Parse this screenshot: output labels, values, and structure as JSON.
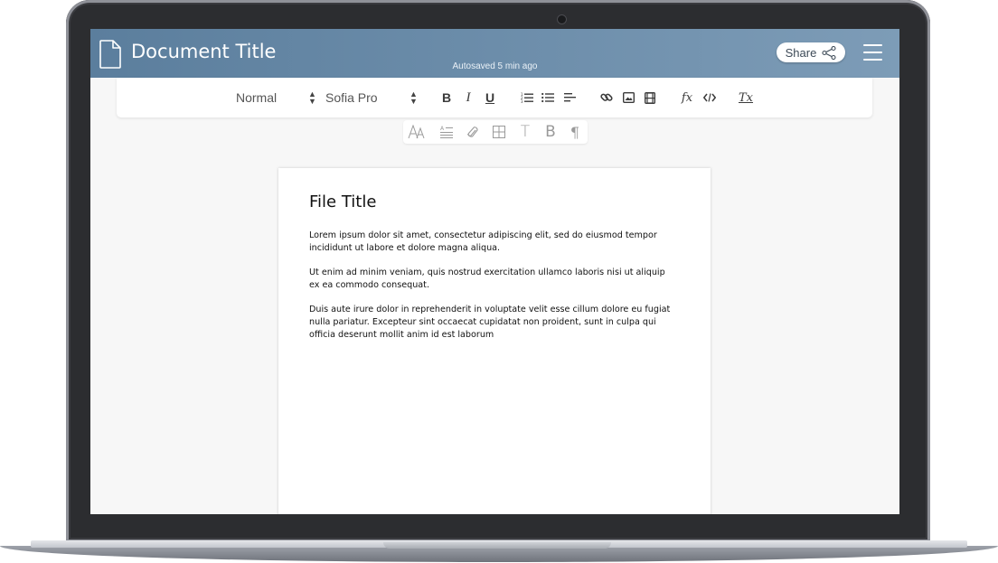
{
  "header": {
    "document_title": "Document Title",
    "autosave_status": "Autosaved 5 min ago",
    "share_label": "Share",
    "share_icon": "share-icon",
    "menu_icon": "hamburger-icon",
    "accent_gradient": [
      "#5b7e9d",
      "#7d9cb7"
    ]
  },
  "toolbar": {
    "style_select": "Normal",
    "font_select": "Sofia Pro",
    "buttons": {
      "bold": "B",
      "italic": "I",
      "underline": "U"
    },
    "icons": [
      "ordered-list-icon",
      "bullet-list-icon",
      "align-left-icon",
      "link-icon",
      "image-icon",
      "video-icon",
      "formula-icon",
      "code-icon",
      "clear-format-icon"
    ],
    "formula_label": "fx",
    "clear_label": "Tx"
  },
  "sub_toolbar": {
    "icons": [
      "font-icon",
      "text-style-icon",
      "attachment-icon",
      "table-icon",
      "text-icon",
      "bold-icon",
      "paragraph-icon"
    ],
    "text_label": "T",
    "bold_label": "B",
    "paragraph_label": "¶"
  },
  "document": {
    "file_title": "File Title",
    "paragraphs": [
      "Lorem ipsum dolor sit amet, consectetur adipiscing elit, sed do eiusmod tempor incididunt ut labore et dolore magna aliqua.",
      "Ut enim ad minim veniam, quis nostrud exercitation ullamco laboris nisi ut aliquip ex ea commodo consequat.",
      "Duis aute irure dolor in reprehenderit in voluptate velit esse cillum dolore eu fugiat nulla pariatur. Excepteur sint occaecat cupidatat non proident, sunt in culpa qui officia deserunt mollit anim id est laborum"
    ]
  }
}
